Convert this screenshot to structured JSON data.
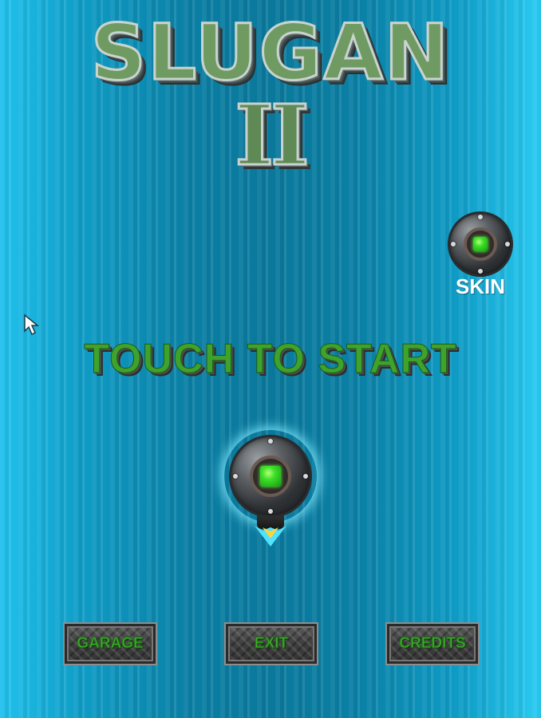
{
  "title": {
    "main": "SLUGAN",
    "numeral": "II"
  },
  "skin": {
    "label": "SKIN"
  },
  "prompt": {
    "touch_to_start": "TOUCH TO START"
  },
  "buttons": {
    "garage": "GARAGE",
    "exit": "EXIT",
    "credits": "CREDITS"
  },
  "icons": {
    "skin": "pod-skin-icon",
    "ship": "player-ship-icon",
    "cursor": "mouse-pointer-icon"
  },
  "colors": {
    "accent_green": "#3ea22d",
    "background_cyan": "#0f9cc6",
    "label_white": "#ffffff"
  }
}
